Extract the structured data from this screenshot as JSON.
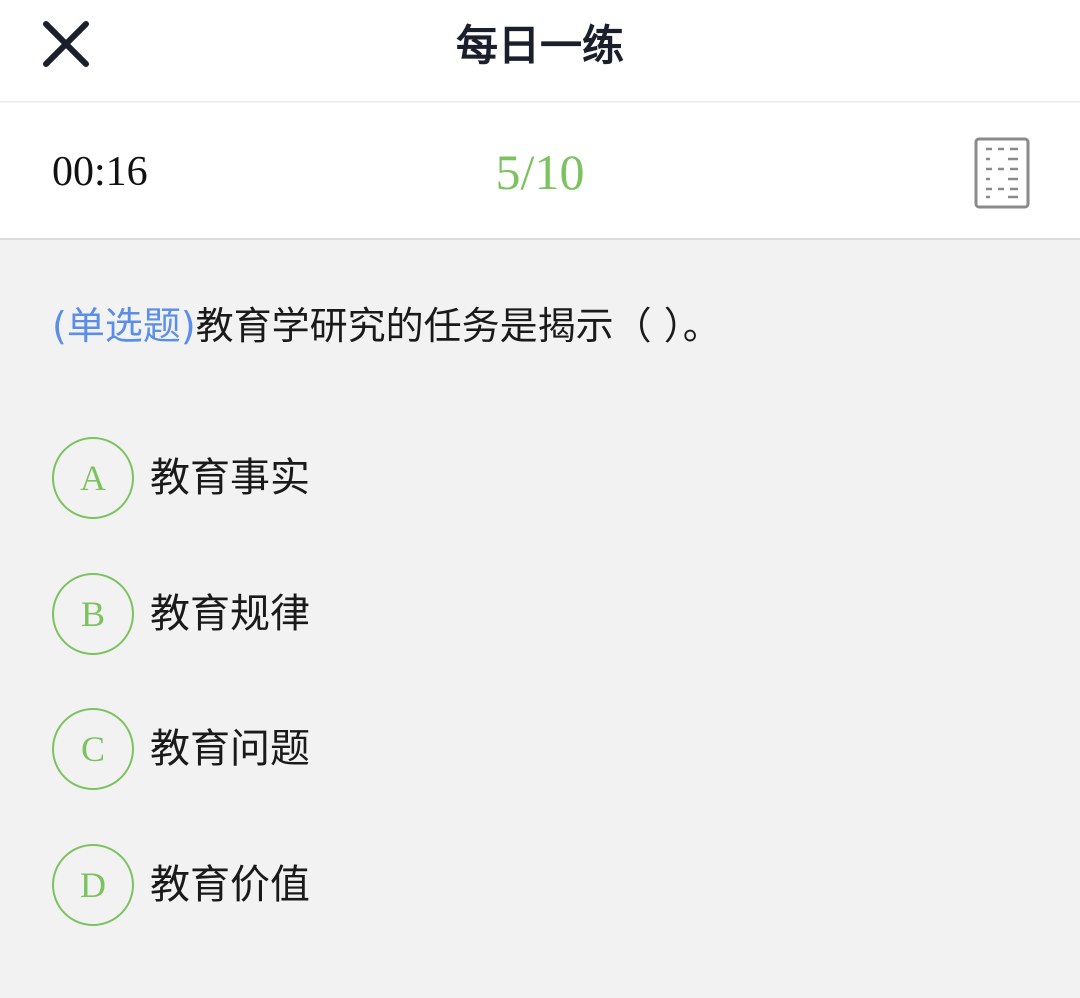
{
  "header": {
    "title": "每日一练",
    "close_icon": "close-icon"
  },
  "status": {
    "timer": "00:16",
    "progress": "5/10",
    "answer_card_icon": "answer-sheet-icon"
  },
  "question": {
    "type_label": "(单选题)",
    "text": "教育学研究的任务是揭示（ ）。"
  },
  "options": [
    {
      "letter": "A",
      "text": "教育事实"
    },
    {
      "letter": "B",
      "text": "教育规律"
    },
    {
      "letter": "C",
      "text": "教育问题"
    },
    {
      "letter": "D",
      "text": "教育价值"
    }
  ],
  "colors": {
    "accent_green": "#7cc35f",
    "question_type_blue": "#5b8ee6",
    "background": "#f2f2f2"
  }
}
